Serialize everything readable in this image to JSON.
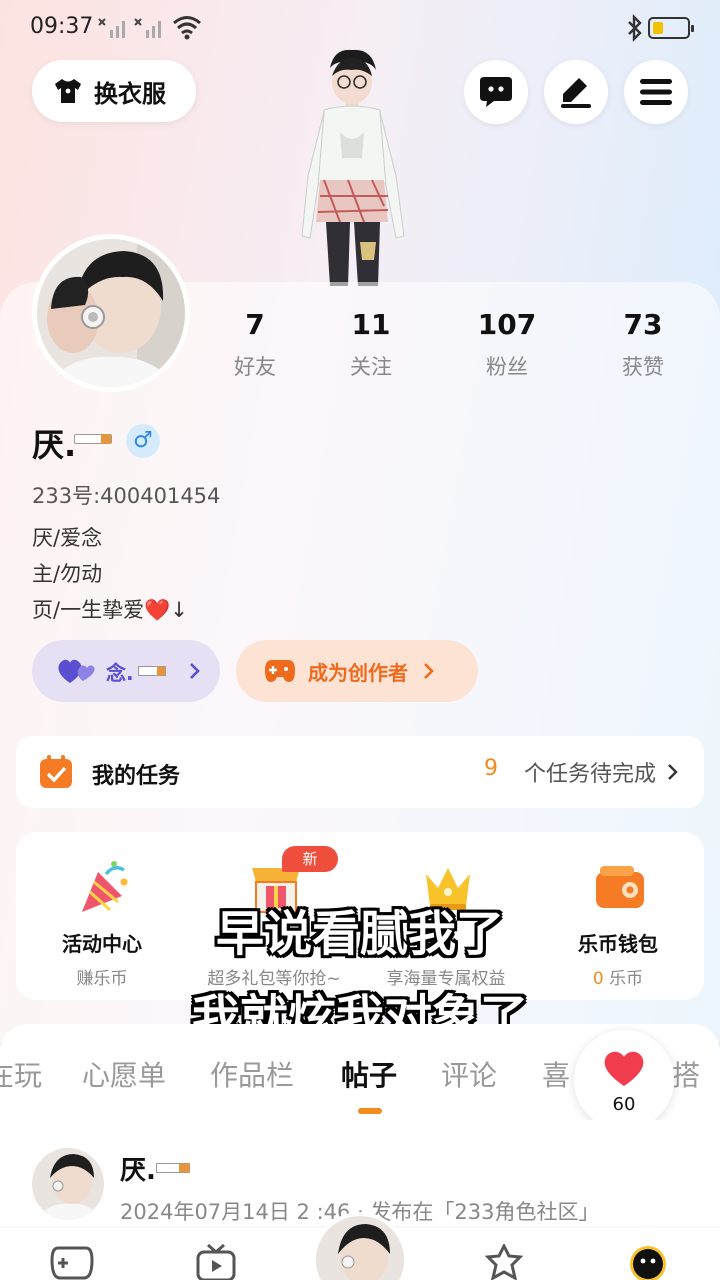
{
  "status_bar": {
    "time": "09:37",
    "icons": [
      "signal-off-icon",
      "signal-off-icon",
      "wifi-icon",
      "bluetooth-icon",
      "battery-icon"
    ],
    "battery_level": 0.3
  },
  "header": {
    "outfit_button": "换衣服",
    "buttons": [
      "chat-icon",
      "edit-icon",
      "menu-icon"
    ]
  },
  "profile": {
    "nickname": "厌.",
    "gender_symbol": "♂",
    "user_id": "233号:400401454",
    "bio": [
      "厌/爱念",
      "主/勿动",
      "页/一生挚爱❤️↓"
    ],
    "stats": [
      {
        "value": "7",
        "label": "好友"
      },
      {
        "value": "11",
        "label": "关注"
      },
      {
        "value": "107",
        "label": "粉丝"
      },
      {
        "value": "73",
        "label": "获赞"
      }
    ],
    "fan_pill": "念.",
    "creator_pill": "成为创作者"
  },
  "task_card": {
    "title": "我的任务",
    "count": "9",
    "rest": "个任务待完成"
  },
  "features": [
    {
      "label": "活动中心",
      "sub": "赚乐币",
      "icon": "party-popper-icon"
    },
    {
      "label": "",
      "sub": "超多礼包等你抢~",
      "icon": "shop-gift-icon",
      "badge": "新"
    },
    {
      "label": "",
      "sub": "享海量专属权益",
      "icon": "crown-icon"
    },
    {
      "label": "乐币钱包",
      "sub_value": "0",
      "sub": "乐币",
      "icon": "wallet-icon"
    }
  ],
  "subtitles": [
    "早说看腻我了",
    "我就炫我对象了"
  ],
  "tabs": [
    "在玩",
    "心愿单",
    "作品栏",
    "帖子",
    "评论",
    "喜",
    "搭"
  ],
  "active_tab": "帖子",
  "like_fab": {
    "count": "60"
  },
  "post": {
    "author": "厌.",
    "meta": "2024年07月14日 2  :46 · 发布在「233角色社区」"
  },
  "colors": {
    "accent": "#f28c1f",
    "fan_pill_bg": "#e6e0f5",
    "fan_pill_text": "#5a4fd0",
    "creator_pill_bg": "#fde3d4",
    "creator_pill_text": "#ee6a1d",
    "gender_blue": "#2e8ae6",
    "like_red": "#f23d4f"
  }
}
